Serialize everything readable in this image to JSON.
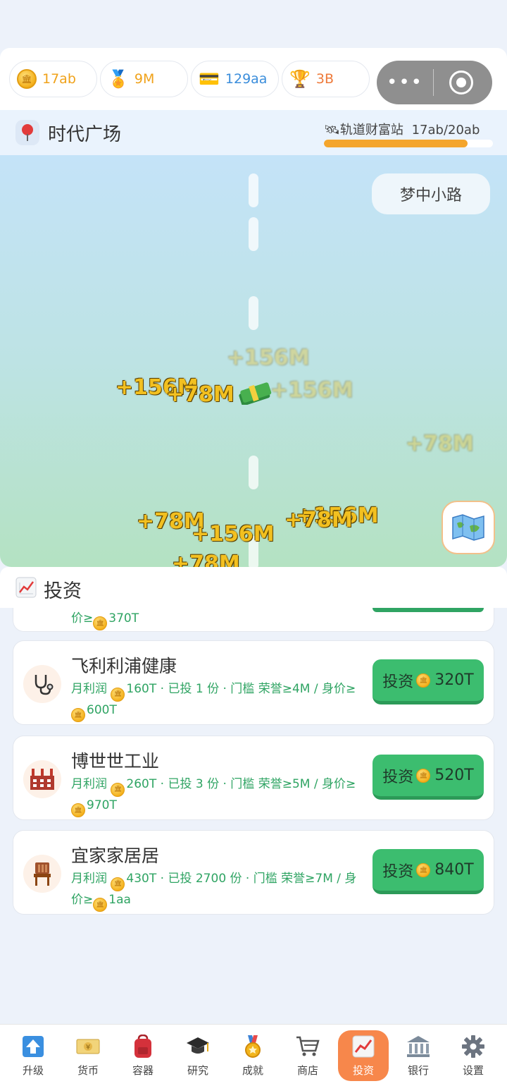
{
  "currencies": [
    {
      "value": "17ab",
      "color": "#f0a21a",
      "icon": "gold-coin-icon"
    },
    {
      "value": "9M",
      "color": "#f0a21a",
      "icon": "medal-icon"
    },
    {
      "value": "129aa",
      "color": "#3a8ddb",
      "icon": "card-icon"
    },
    {
      "value": "3B",
      "color": "#ee7a3a",
      "icon": "trophy-icon"
    }
  ],
  "capsule": {
    "more": "•••"
  },
  "location": {
    "name": "时代广场",
    "station_label": "🛰轨道财富站",
    "station_progress": "17ab/20ab",
    "progress_fraction": 0.85
  },
  "scene": {
    "road_button": "梦中小路",
    "floats": [
      "+156M",
      "+156M",
      "+78M",
      "+156M",
      "+78M",
      "+78M",
      "+156M",
      "+156M",
      "+78M",
      "+78M"
    ]
  },
  "section": {
    "title": "投资"
  },
  "peek": {
    "text": "价≥",
    "amount": "370T"
  },
  "investments": [
    {
      "name": "飞利利浦健康",
      "profit_label": "月利润 ",
      "profit": "160T",
      "detail_mid": " · 已投 1 份 · 门槛 荣誉≥4M / 身价≥",
      "threshold": "600T",
      "button": "投资 ",
      "price": "320T",
      "icon": "stethoscope-icon"
    },
    {
      "name": "博世世工业",
      "profit_label": "月利润 ",
      "profit": "260T",
      "detail_mid": " · 已投 3 份 · 门槛 荣誉≥5M / 身价≥",
      "threshold": "970T",
      "button": "投资 ",
      "price": "520T",
      "icon": "factory-icon"
    },
    {
      "name": "宜家家居居",
      "profit_label": "月利润 ",
      "profit": "430T",
      "detail_mid": " · 已投 2700 份 · 门槛 荣誉≥7M / 身价≥",
      "threshold": "1aa",
      "button": "投资 ",
      "price": "840T",
      "icon": "chair-icon"
    }
  ],
  "tabs": [
    {
      "label": "升级",
      "icon": "upgrade-arrow-icon"
    },
    {
      "label": "货币",
      "icon": "banknote-icon"
    },
    {
      "label": "容器",
      "icon": "backpack-icon"
    },
    {
      "label": "研究",
      "icon": "graduation-cap-icon"
    },
    {
      "label": "成就",
      "icon": "medal-icon"
    },
    {
      "label": "商店",
      "icon": "cart-icon"
    },
    {
      "label": "投资",
      "icon": "chart-icon",
      "active": true
    },
    {
      "label": "银行",
      "icon": "bank-icon"
    },
    {
      "label": "设置",
      "icon": "gear-icon"
    }
  ]
}
